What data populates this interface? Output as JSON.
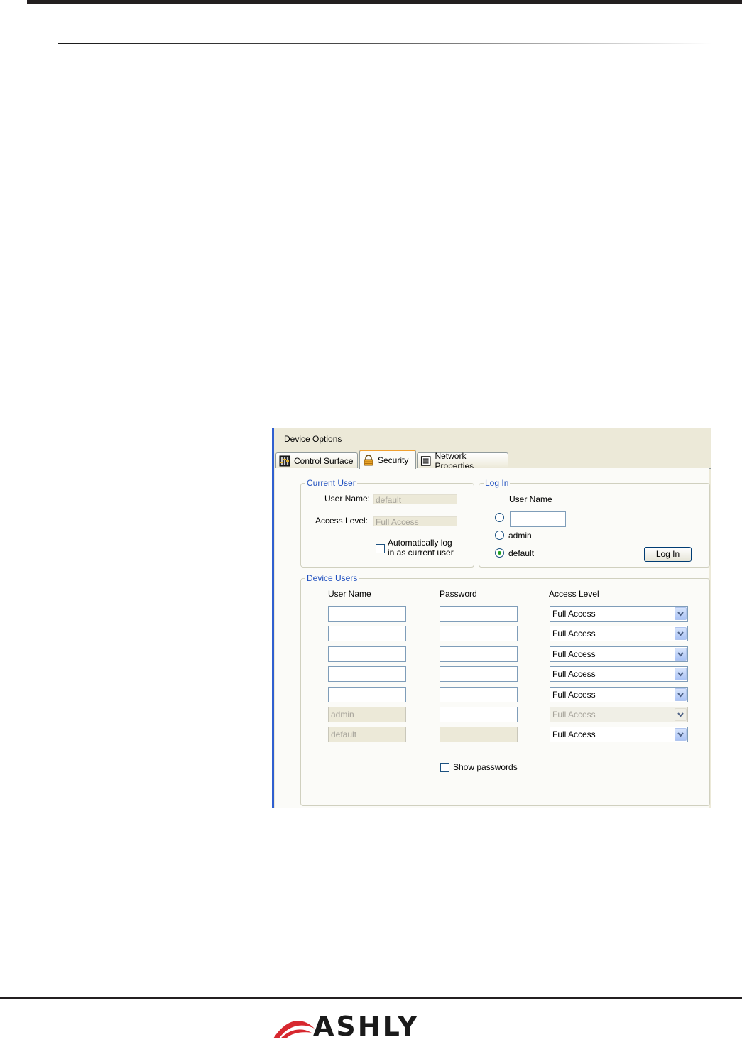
{
  "brand": {
    "logo_text": "ASHLY"
  },
  "dialog": {
    "title": "Device Options",
    "tabs": [
      {
        "label": "Control Surface",
        "icon": "control-surface-icon"
      },
      {
        "label": "Security",
        "icon": "padlock-icon",
        "active": true
      },
      {
        "label": "Network Properties",
        "icon": "network-properties-icon"
      }
    ]
  },
  "current_user": {
    "legend": "Current User",
    "user_name_label": "User Name:",
    "user_name_value": "default",
    "access_level_label": "Access Level:",
    "access_level_value": "Full Access",
    "auto_login_line1": "Automatically log",
    "auto_login_line2": "in as current user",
    "auto_login_checked": false
  },
  "log_in": {
    "legend": "Log In",
    "user_name_header": "User Name",
    "options": [
      {
        "label": "",
        "has_textbox": true,
        "selected": false
      },
      {
        "label": "admin",
        "selected": false
      },
      {
        "label": "default",
        "selected": true
      }
    ],
    "button_label": "Log In"
  },
  "device_users": {
    "legend": "Device Users",
    "headers": {
      "user_name": "User Name",
      "password": "Password",
      "access_level": "Access Level"
    },
    "rows": [
      {
        "user_name": "",
        "password": "",
        "access_level": "Full Access",
        "name_disabled": false,
        "password_disabled": false,
        "level_disabled": false
      },
      {
        "user_name": "",
        "password": "",
        "access_level": "Full Access",
        "name_disabled": false,
        "password_disabled": false,
        "level_disabled": false
      },
      {
        "user_name": "",
        "password": "",
        "access_level": "Full Access",
        "name_disabled": false,
        "password_disabled": false,
        "level_disabled": false
      },
      {
        "user_name": "",
        "password": "",
        "access_level": "Full Access",
        "name_disabled": false,
        "password_disabled": false,
        "level_disabled": false
      },
      {
        "user_name": "",
        "password": "",
        "access_level": "Full Access",
        "name_disabled": false,
        "password_disabled": false,
        "level_disabled": false
      },
      {
        "user_name": "admin",
        "password": "",
        "access_level": "Full Access",
        "name_disabled": true,
        "password_disabled": false,
        "level_disabled": true
      },
      {
        "user_name": "default",
        "password": "",
        "access_level": "Full Access",
        "name_disabled": true,
        "password_disabled": true,
        "level_disabled": false
      }
    ],
    "show_passwords_label": "Show passwords",
    "show_passwords_checked": false
  },
  "colors": {
    "accent_blue": "#1f4fbf",
    "dialog_bg": "#ece9d8",
    "tab_highlight": "#f0a030",
    "brand_red": "#d7282f"
  }
}
